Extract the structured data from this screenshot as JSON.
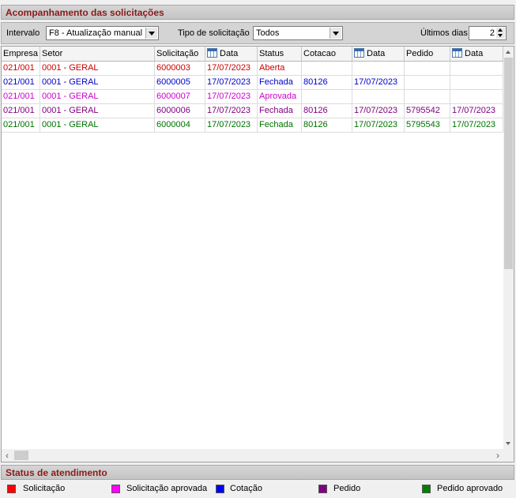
{
  "panel_title": "Acompanhamento das solicitações",
  "filters": {
    "interval_label": "Intervalo",
    "interval_value": "F8 - Atualização manual",
    "type_label": "Tipo de solicitação",
    "type_value": "Todos",
    "days_label": "Últimos dias",
    "days_value": "2"
  },
  "columns": [
    "Empresa",
    "Setor",
    "Solicitação",
    "Data",
    "Status",
    "Cotacao",
    "Data",
    "Pedido",
    "Data"
  ],
  "rows": [
    {
      "color": "#cc0000",
      "cells": [
        "021/001",
        "0001 - GERAL",
        "6000003",
        "17/07/2023",
        "Aberta",
        "",
        "",
        "",
        ""
      ]
    },
    {
      "color": "#0000cc",
      "cells": [
        "021/001",
        "0001 - GERAL",
        "6000005",
        "17/07/2023",
        "Fechada",
        "80126",
        "17/07/2023",
        "",
        ""
      ]
    },
    {
      "color": "#cc00cc",
      "cells": [
        "021/001",
        "0001 - GERAL",
        "6000007",
        "17/07/2023",
        "Aprovada",
        "",
        "",
        "",
        ""
      ]
    },
    {
      "color": "#800080",
      "cells": [
        "021/001",
        "0001 - GERAL",
        "6000006",
        "17/07/2023",
        "Fechada",
        "80126",
        "17/07/2023",
        "5795542",
        "17/07/2023"
      ]
    },
    {
      "color": "#007000",
      "cells": [
        "021/001",
        "0001 - GERAL",
        "6000004",
        "17/07/2023",
        "Fechada",
        "80126",
        "17/07/2023",
        "5795543",
        "17/07/2023"
      ]
    }
  ],
  "status_title": "Status de atendimento",
  "legend": [
    {
      "label": "Solicitação",
      "color": "#ff0000"
    },
    {
      "label": "Solicitação aprovada",
      "color": "#ff00ff"
    },
    {
      "label": "Cotação",
      "color": "#0000ff"
    },
    {
      "label": "Pedido",
      "color": "#800080"
    },
    {
      "label": "Pedido aprovado",
      "color": "#008000"
    }
  ],
  "scroll_left_glyph": "‹",
  "scroll_right_glyph": "›"
}
